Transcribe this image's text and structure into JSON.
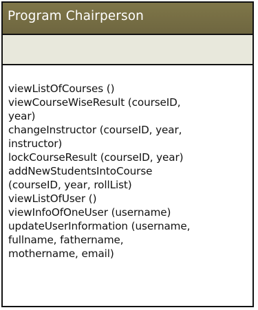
{
  "class_box": {
    "name": "Program Chairperson",
    "attributes": [],
    "operations": [
      "viewListOfCourses ()",
      "viewCourseWiseResult (courseID,",
      "year)",
      "changeInstructor (courseID, year,",
      "instructor)",
      "lockCourseResult (courseID, year)",
      "addNewStudentsIntoCourse",
      "(courseID, year, rollList)",
      "viewListOfUser ()",
      "viewInfoOfOneUser (username)",
      "updateUserInformation (username,",
      "fullname, fathername,",
      "mothername, email)"
    ]
  },
  "colors": {
    "header_fill": "#7f7648",
    "attribute_fill": "#e8e8dc",
    "border": "#111111",
    "header_text": "#ffffff"
  }
}
